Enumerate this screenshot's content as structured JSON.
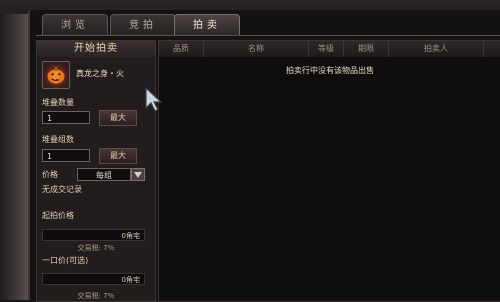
{
  "tabs": [
    {
      "label": "浏览"
    },
    {
      "label": "竞拍"
    },
    {
      "label": "拍卖"
    }
  ],
  "left_panel": {
    "title": "开始拍卖",
    "item_name": "真龙之身・火",
    "stack_qty_label": "堆叠数量",
    "stack_qty_value": "1",
    "stack_groups_label": "堆叠组数",
    "stack_groups_value": "1",
    "max_label": "最大",
    "price_label": "价格",
    "price_unit_selected": "每组",
    "no_trade_record": "无成交记录",
    "start_price_label": "起拍价格",
    "start_price_value": "0角宅",
    "tax_text": "交易税: 7%",
    "buyout_label": "一口价(可选)",
    "buyout_value": "0角宅",
    "tax_text_2": "交易税: 7%"
  },
  "table": {
    "columns": [
      "品质",
      "名称",
      "等级",
      "期限",
      "拍卖人",
      ""
    ],
    "empty_message": "拍卖行中没有该物品出售"
  },
  "colors": {
    "accent_text": "#e9d9b5",
    "panel_bg": "#221c1d",
    "main_bg": "#0e0c0c"
  }
}
